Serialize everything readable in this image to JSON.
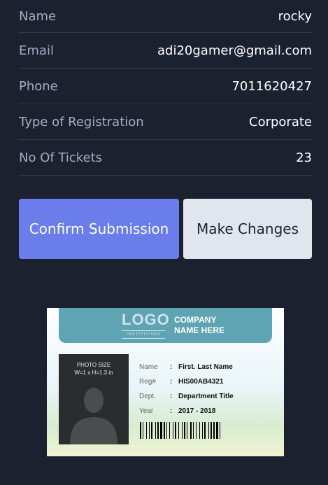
{
  "details": [
    {
      "label": "Name",
      "value": "rocky"
    },
    {
      "label": "Email",
      "value": "adi20gamer@gmail.com"
    },
    {
      "label": "Phone",
      "value": "7011620427"
    },
    {
      "label": "Type of Registration",
      "value": "Corporate"
    },
    {
      "label": "No Of Tickets",
      "value": "23"
    }
  ],
  "actions": {
    "confirm_label": "Confirm Submission",
    "change_label": "Make Changes"
  },
  "id_card": {
    "logo": "LOGO",
    "logo_sub": "INSTITUTION",
    "company_line1": "COMPANY",
    "company_line2": "NAME HERE",
    "photo_line1": "PHOTO SIZE",
    "photo_line2": "W=1 x H=1.3 in",
    "fields": [
      {
        "key": "Name",
        "value": "First. Last Name"
      },
      {
        "key": "Reg#",
        "value": "HIS00AB4321"
      },
      {
        "key": "Dept.",
        "value": "Department Title"
      },
      {
        "key": "Year",
        "value": "2017 - 2018"
      }
    ],
    "colors": {
      "header": "#5fa4b3"
    }
  }
}
